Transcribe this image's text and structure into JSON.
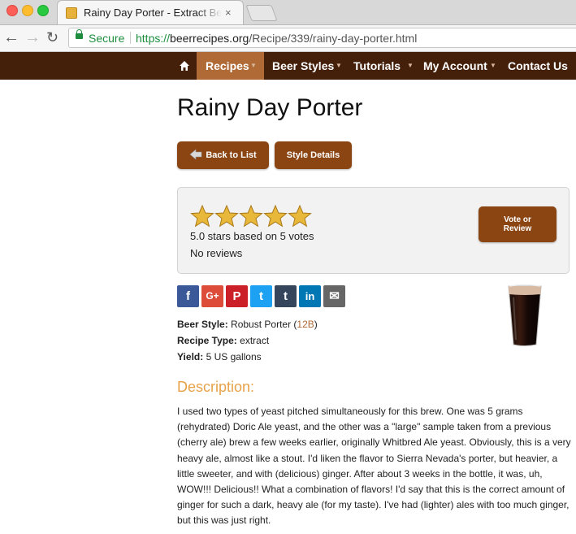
{
  "browser": {
    "tab_title": "Rainy Day Porter - Extract Beer Recipe",
    "tab_close": "×",
    "secure_label": "Secure",
    "url_protocol": "https://",
    "url_host": "beerrecipes.org",
    "url_path": "/Recipe/339/rainy-day-porter.html"
  },
  "nav": {
    "items": [
      {
        "label": "Recipes",
        "active": true,
        "has_caret": true
      },
      {
        "label": "Beer Styles",
        "has_caret": true
      },
      {
        "label": "Tutorials",
        "has_caret": true
      },
      {
        "label": "My Account",
        "has_caret": true
      },
      {
        "label": "Contact Us"
      }
    ],
    "caret": "▼",
    "home_icon": "home-icon"
  },
  "recipe": {
    "title": "Rainy Day Porter",
    "back_button": "Back to List",
    "style_button": "Style Details",
    "rating": {
      "stars": 5,
      "max_stars": 5,
      "summary": "5.0 stars based on 5 votes",
      "reviews": "No reviews",
      "vote_button": "Vote or Review"
    },
    "share_icons": [
      "facebook-icon",
      "google-plus-icon",
      "pinterest-icon",
      "twitter-icon",
      "tumblr-icon",
      "linkedin-icon",
      "email-icon"
    ],
    "share_glyphs": {
      "facebook": "f",
      "google_plus": "G+",
      "pinterest": "P",
      "twitter": "t",
      "tumblr": "t",
      "linkedin": "in",
      "email": "✉"
    },
    "beer_style_label": "Beer Style:",
    "beer_style_value": "Robust Porter (",
    "beer_style_code": "12B",
    "beer_style_close": ")",
    "recipe_type_label": "Recipe Type:",
    "recipe_type_value": "extract",
    "yield_label": "Yield:",
    "yield_value": "5 US gallons",
    "description_heading": "Description:",
    "description": "I used two types of yeast pitched simultaneously for this brew. One was 5 grams (rehydrated) Doric Ale yeast, and the other was a \"large\" sample taken from a previous (cherry ale) brew a few weeks earlier, originally Whitbred Ale yeast. Obviously, this is a very heavy ale, almost like a stout. I'd liken the flavor to Sierra Nevada's porter, but heavier, a little sweeter, and with (delicious) ginger. After about 3 weeks in the bottle, it was, uh, WOW!!! Delicious!! What a combination of flavors! I'd say that this is the correct amount of ginger for such a dark, heavy ale (for my taste). I've had (lighter) ales with too much ginger, but this was just right."
  },
  "colors": {
    "nav_bg": "#44200b",
    "nav_active": "#b06a36",
    "button": "#8b4513",
    "heading_accent": "#e8a24a"
  }
}
